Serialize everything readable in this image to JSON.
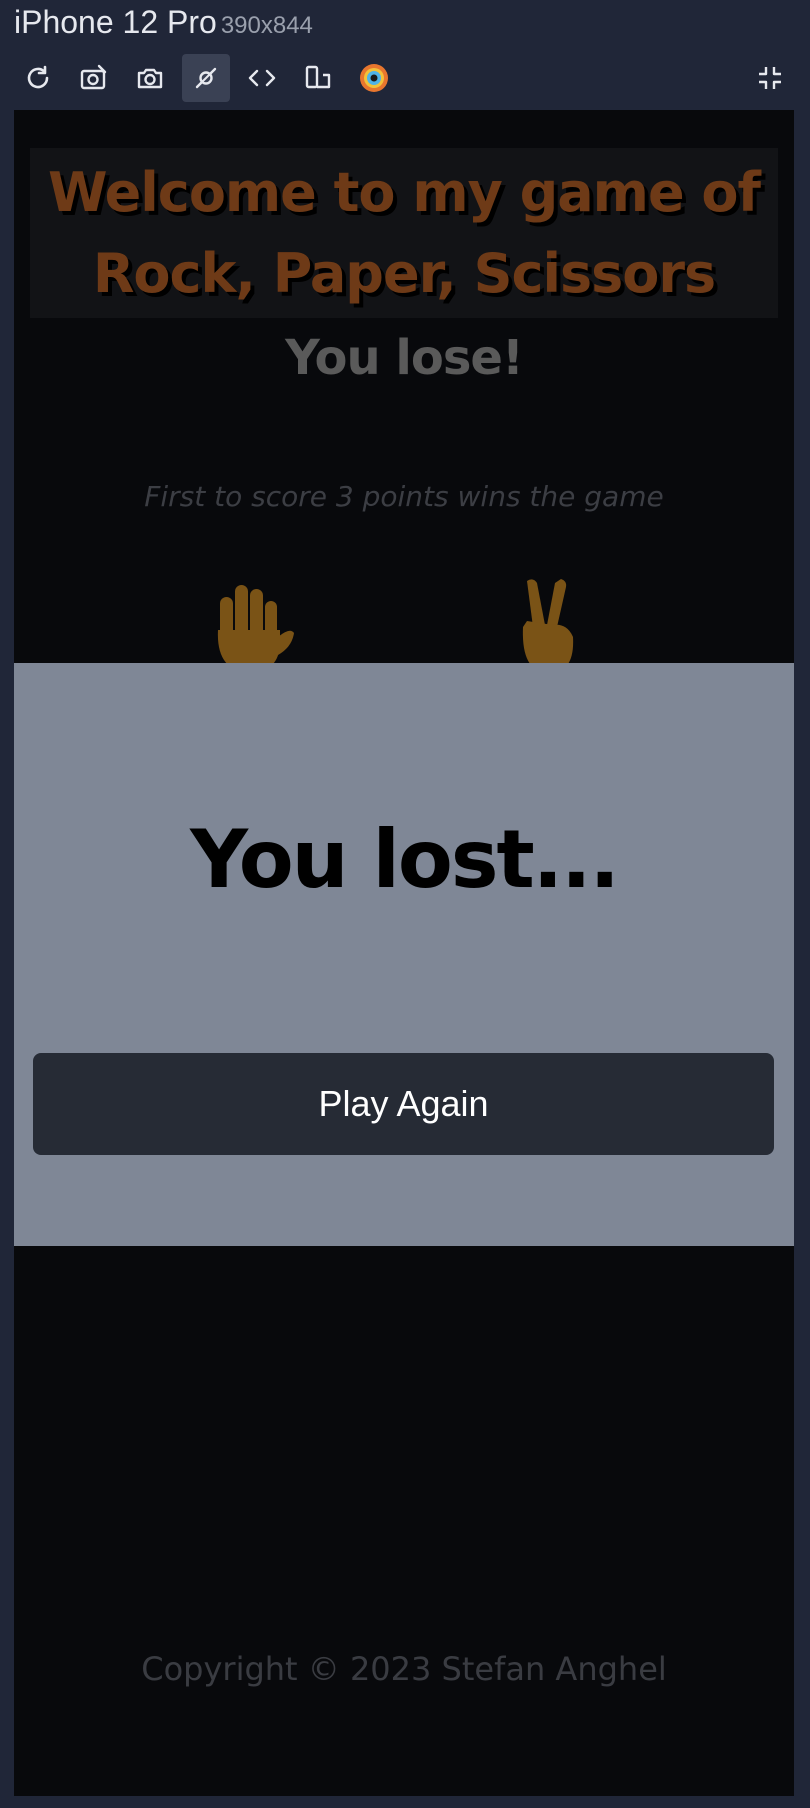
{
  "devtools": {
    "device_name": "iPhone 12 Pro",
    "device_dims": "390x844",
    "toolbar_icons": [
      "refresh-icon",
      "screenshot-edit-icon",
      "camera-icon",
      "inspect-icon",
      "code-icon",
      "device-rotate-icon",
      "color-wheel-icon",
      "exit-fullscreen-icon"
    ]
  },
  "page": {
    "title": "Welcome to my game of Rock, Paper, Scissors",
    "round_result": "You lose!",
    "rules": "First to score 3 points wins the game",
    "player_hand": "paper-hand-icon",
    "computer_hand": "scissors-hand-icon",
    "footer": "Copyright © 2023 Stefan Anghel"
  },
  "modal": {
    "heading": "You lost...",
    "button_label": "Play Again"
  },
  "colors": {
    "devtools_bg": "#202638",
    "page_bg": "#08090c",
    "title_color": "#6e3a17",
    "modal_bg": "#7f8796",
    "button_bg": "#262b35",
    "hand_color": "#7a5316"
  }
}
